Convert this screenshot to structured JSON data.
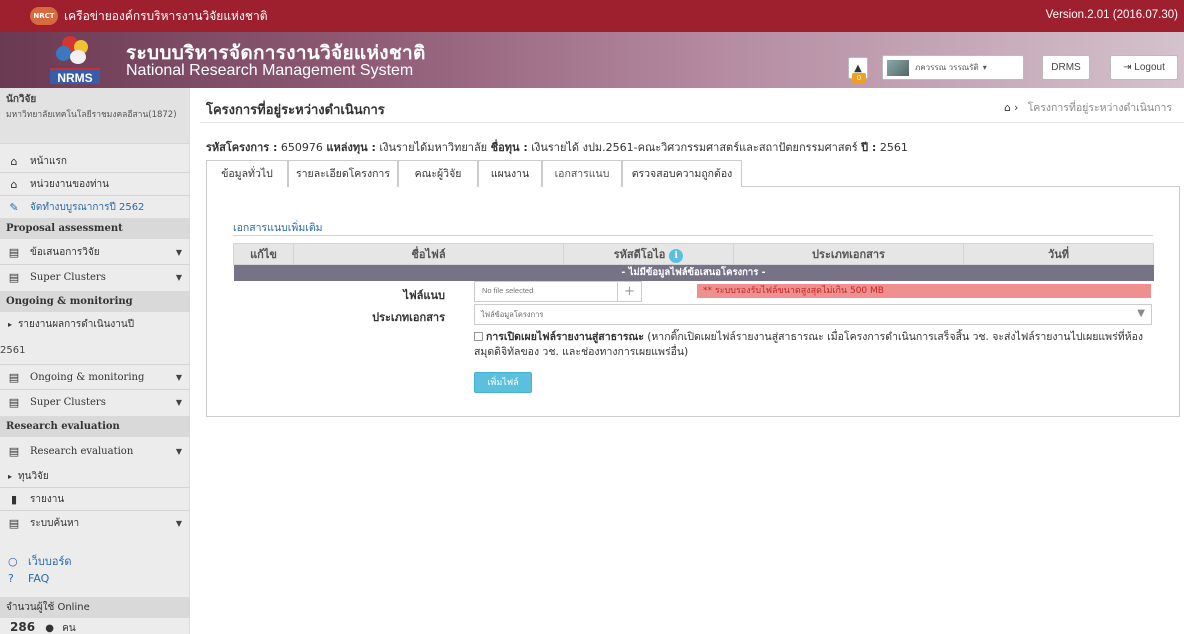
{
  "topbar": {
    "logo_text": "NRCT",
    "network_title": "เครือข่ายองค์กรบริหารงานวิจัยแห่งชาติ",
    "version": "Version.2.01 (2016.07.30)"
  },
  "header": {
    "logo_label": "NRMS",
    "system_th": "ระบบบริหารจัดการงานวิจัยแห่งชาติ",
    "system_en": "National Research Management System",
    "notif_count": "0",
    "user_name": "ภควรรณ วรรณรัติ",
    "drms_label": "DRMS",
    "logout_label": "Logout"
  },
  "sidebar": {
    "role": "นักวิจัย",
    "org": "มหาวิทยาลัยเทคโนโลยีราชมงคลอีสาน(1872)",
    "home": "หน้าแรก",
    "my_unit": "หน่วยงานของท่าน",
    "budget": "จัดทำงบบูรณาการปี 2562",
    "proposal_head": "Proposal assessment",
    "research_proposal": "ข้อเสนอการวิจัย",
    "super_clusters_1": "Super Clusters",
    "ongoing_head": "Ongoing & monitoring",
    "report_progress": "รายงานผลการดำเนินงานปี",
    "report_year": "2561",
    "ongoing_item": "Ongoing & monitoring",
    "super_clusters_2": "Super Clusters",
    "eval_head": "Research evaluation",
    "eval_item": "Research evaluation",
    "fund": "ทุนวิจัย",
    "report": "รายงาน",
    "search": "ระบบค้นหา",
    "webboard": "เว็บบอร์ด",
    "faq": "FAQ",
    "online_label": "จำนวนผู้ใช้ Online",
    "online_count": "286",
    "online_unit": "คน"
  },
  "main": {
    "title": "โครงการที่อยู่ระหว่างดำเนินการ",
    "breadcrumb": "โครงการที่อยู่ระหว่างดำเนินการ",
    "project": {
      "code_label": "รหัสโครงการ :",
      "code": "650976",
      "source_label": "แหล่งทุน :",
      "source": "เงินรายได้มหาวิทยาลัย",
      "fund_label": "ชื่อทุน :",
      "fund": "เงินรายได้ งปม.2561-คณะวิศวกรรมศาสตร์และสถาปัตยกรรมศาสตร์",
      "year_label": "ปี :",
      "year": "2561"
    },
    "tabs": [
      "ข้อมูลทั่วไป",
      "รายละเอียดโครงการ",
      "คณะผู้วิจัย",
      "แผนงาน",
      "เอกสารแนบ",
      "ตรวจสอบความถูกต้อง"
    ],
    "section_title": "เอกสารแนบเพิ่มเติม",
    "columns": [
      "แก้ไข",
      "ชื่อไฟล์",
      "รหัสดีโอไอ",
      "ประเภทเอกสาร",
      "วันที่"
    ],
    "empty_msg": "- ไม่มีข้อมูลไฟล์ข้อเสนอโครงการ -",
    "file_label": "ไฟล์แนบ",
    "file_placeholder": "No file selected",
    "file_warning": "** ระบบรองรับไฟล์ขนาดสูงสุดไม่เกิน 500 MB",
    "doctype_label": "ประเภทเอกสาร",
    "doctype_value": "ไฟล์ข้อมูลโครงการ",
    "publish_bold": "การเปิดเผยไฟล์รายงานสู่สาธารณะ",
    "publish_text": "(หากติ๊กเปิดเผยไฟล์รายงานสู่สาธารณะ เมื่อโครงการดำเนินการเสร็จสิ้น วช. จะส่งไฟล์รายงานไปเผยแพร่ที่ห้องสมุดดิจิทัลของ วช. และช่องทางการเผยแพร่อื่น)",
    "add_button": "เพิ่มไฟล์"
  },
  "colors": {
    "topbar": "#9e1f2e",
    "link": "#2a6aa8",
    "empty_row": "#777387",
    "warning_bg": "#ef8f8f",
    "add_button": "#5bc0de"
  }
}
